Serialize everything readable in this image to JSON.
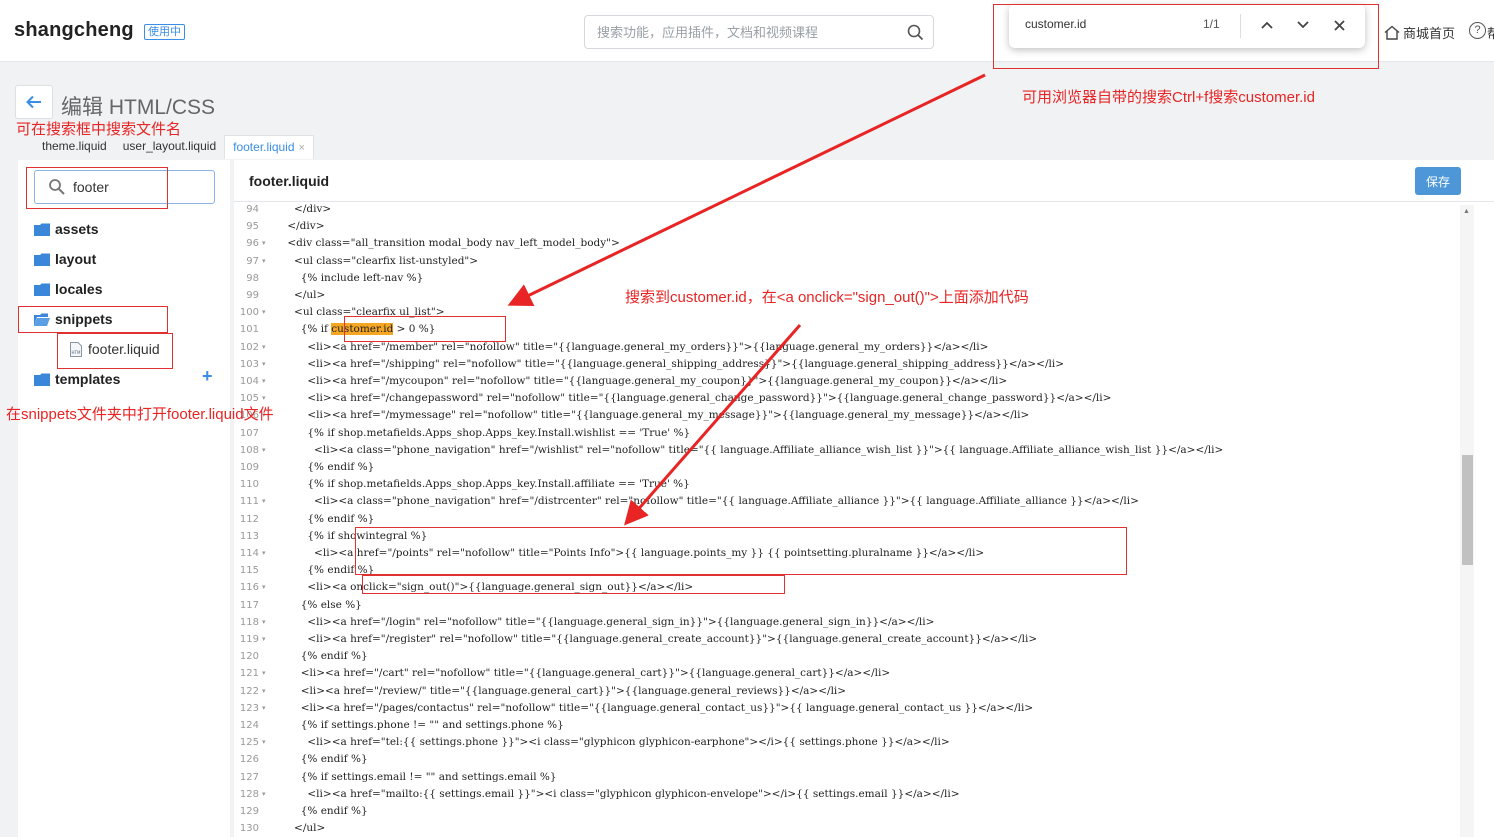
{
  "header": {
    "brand": "shangcheng",
    "badge": "使用中",
    "search_placeholder": "搜索功能，应用插件，文档和视频课程",
    "home_label": "商城首页",
    "help_label": "帮"
  },
  "find_bar": {
    "query": "customer.id",
    "count": "1/1"
  },
  "page": {
    "title": "编辑 HTML/CSS"
  },
  "tabs": [
    {
      "label": "theme.liquid"
    },
    {
      "label": "user_layout.liquid"
    },
    {
      "label": "footer.liquid",
      "close": "×"
    }
  ],
  "sidebar": {
    "search_value": "footer",
    "folders": [
      "assets",
      "layout",
      "locales",
      "snippets",
      "templates"
    ],
    "open_file": "footer.liquid",
    "add_symbol": "+"
  },
  "editor": {
    "file_title": "footer.liquid",
    "save_label": "保存",
    "lines": [
      {
        "n": "94",
        "fold": false,
        "pre": "      </div>"
      },
      {
        "n": "95",
        "fold": false,
        "pre": "    </div>"
      },
      {
        "n": "96",
        "fold": true,
        "pre": "    <div class=\"all_transition modal_body nav_left_model_body\">"
      },
      {
        "n": "97",
        "fold": true,
        "pre": "      <ul class=\"clearfix list-unstyled\">"
      },
      {
        "n": "98",
        "fold": false,
        "pre": "        {% include left-nav %}"
      },
      {
        "n": "99",
        "fold": false,
        "pre": "      </ul>"
      },
      {
        "n": "100",
        "fold": true,
        "pre": "      <ul class=\"clearfix ul_list\">"
      },
      {
        "n": "101",
        "fold": false,
        "pre": "        {% if ",
        "hl": "customer.id",
        "post": " > 0 %}"
      },
      {
        "n": "102",
        "fold": true,
        "pre": "          <li><a href=\"/member\" rel=\"nofollow\" title=\"{{language.general_my_orders}}\">{{language.general_my_orders}}</a></li>"
      },
      {
        "n": "103",
        "fold": true,
        "pre": "          <li><a href=\"/shipping\" rel=\"nofollow\" title=\"{{language.general_shipping_address}}\">{{language.general_shipping_address}}</a></li>"
      },
      {
        "n": "104",
        "fold": true,
        "pre": "          <li><a href=\"/mycoupon\" rel=\"nofollow\" title=\"{{language.general_my_coupon}}\">{{language.general_my_coupon}}</a></li>"
      },
      {
        "n": "105",
        "fold": true,
        "pre": "          <li><a href=\"/changepassword\" rel=\"nofollow\" title=\"{{language.general_change_password}}\">{{language.general_change_password}}</a></li>"
      },
      {
        "n": "106",
        "fold": true,
        "pre": "          <li><a href=\"/mymessage\" rel=\"nofollow\" title=\"{{language.general_my_message}}\">{{language.general_my_message}}</a></li>"
      },
      {
        "n": "107",
        "fold": false,
        "pre": "          {% if shop.metafields.Apps_shop.Apps_key.Install.wishlist == 'True' %}"
      },
      {
        "n": "108",
        "fold": true,
        "pre": "            <li><a class=\"phone_navigation\" href=\"/wishlist\" rel=\"nofollow\" title=\"{{ language.Affiliate_alliance_wish_list }}\">{{ language.Affiliate_alliance_wish_list }}</a></li>"
      },
      {
        "n": "109",
        "fold": false,
        "pre": "          {% endif %}"
      },
      {
        "n": "110",
        "fold": false,
        "pre": "          {% if shop.metafields.Apps_shop.Apps_key.Install.affiliate == 'True' %}"
      },
      {
        "n": "111",
        "fold": true,
        "pre": "            <li><a class=\"phone_navigation\" href=\"/distrcenter\" rel=\"nofollow\" title=\"{{ language.Affiliate_alliance }}\">{{ language.Affiliate_alliance }}</a></li>"
      },
      {
        "n": "112",
        "fold": false,
        "pre": "          {% endif %}"
      },
      {
        "n": "113",
        "fold": false,
        "pre": "          {% if showintegral %}"
      },
      {
        "n": "114",
        "fold": true,
        "pre": "            <li><a href=\"/points\" rel=\"nofollow\" title=\"Points Info\">{{ language.points_my }} {{ pointsetting.pluralname }}</a></li>"
      },
      {
        "n": "115",
        "fold": false,
        "pre": "          {% endif %}"
      },
      {
        "n": "116",
        "fold": true,
        "pre": "          <li><a onclick=\"sign_out()\">{{language.general_sign_out}}</a></li>"
      },
      {
        "n": "117",
        "fold": false,
        "pre": "        {% else %}"
      },
      {
        "n": "118",
        "fold": true,
        "pre": "          <li><a href=\"/login\" rel=\"nofollow\" title=\"{{language.general_sign_in}}\">{{language.general_sign_in}}</a></li>"
      },
      {
        "n": "119",
        "fold": true,
        "pre": "          <li><a href=\"/register\" rel=\"nofollow\" title=\"{{language.general_create_account}}\">{{language.general_create_account}}</a></li>"
      },
      {
        "n": "120",
        "fold": false,
        "pre": "        {% endif %}"
      },
      {
        "n": "121",
        "fold": true,
        "pre": "        <li><a href=\"/cart\" rel=\"nofollow\" title=\"{{language.general_cart}}\">{{language.general_cart}}</a></li>"
      },
      {
        "n": "122",
        "fold": true,
        "pre": "        <li><a href=\"/review/\" title=\"{{language.general_cart}}\">{{language.general_reviews}}</a></li>"
      },
      {
        "n": "123",
        "fold": true,
        "pre": "        <li><a href=\"/pages/contactus\" rel=\"nofollow\" title=\"{{language.general_contact_us}}\">{{ language.general_contact_us }}</a></li>"
      },
      {
        "n": "124",
        "fold": false,
        "pre": "        {% if settings.phone != \"\" and settings.phone %}"
      },
      {
        "n": "125",
        "fold": true,
        "pre": "          <li><a href=\"tel:{{ settings.phone }}\"><i class=\"glyphicon glyphicon-earphone\"></i>{{ settings.phone }}</a></li>"
      },
      {
        "n": "126",
        "fold": false,
        "pre": "        {% endif %}"
      },
      {
        "n": "127",
        "fold": false,
        "pre": "        {% if settings.email != \"\" and settings.email %}"
      },
      {
        "n": "128",
        "fold": true,
        "pre": "          <li><a href=\"mailto:{{ settings.email }}\"><i class=\"glyphicon glyphicon-envelope\"></i>{{ settings.email }}</a></li>"
      },
      {
        "n": "129",
        "fold": false,
        "pre": "        {% endif %}"
      },
      {
        "n": "130",
        "fold": false,
        "pre": "      </ul>"
      }
    ]
  },
  "annotations": {
    "find_hint": "可用浏览器自带的搜索Ctrl+f搜索customer.id",
    "search_hint": "可在搜索框中搜索文件名",
    "snippets_hint": "在snippets文件夹中打开footer.liquid文件",
    "code_hint": "搜索到customer.id，在<a onclick=\"sign_out()\">上面添加代码",
    "color": "#e82424"
  }
}
